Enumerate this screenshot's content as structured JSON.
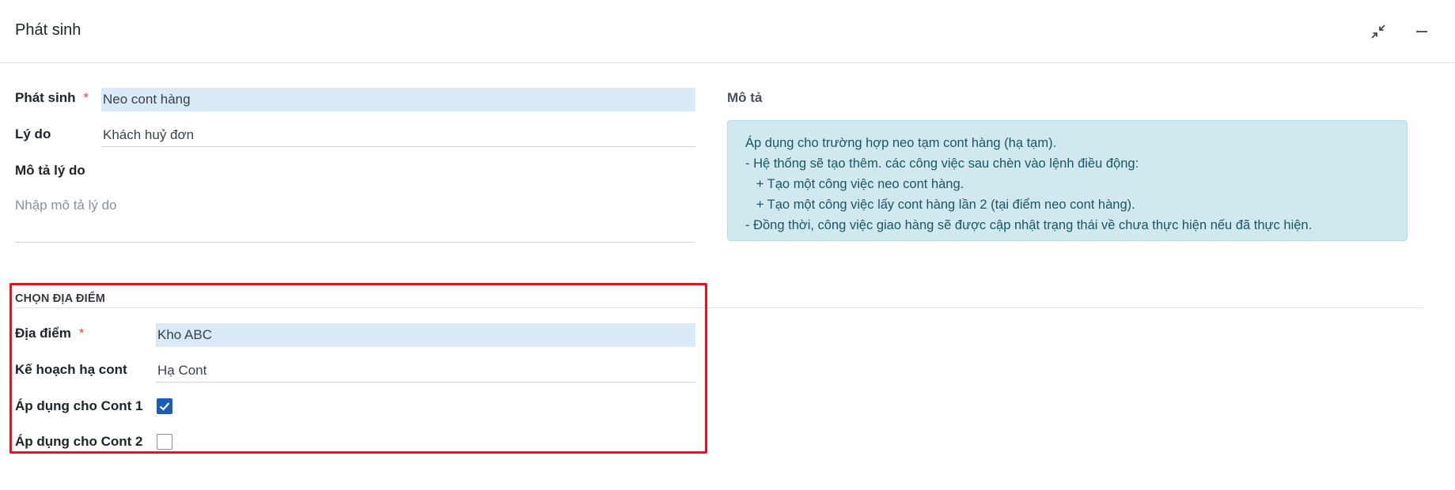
{
  "dialog": {
    "title": "Phát sinh"
  },
  "form": {
    "phat_sinh_label": "Phát sinh",
    "phat_sinh_value": "Neo cont hàng",
    "ly_do_label": "Lý do",
    "ly_do_value": "Khách huỷ đơn",
    "mo_ta_ly_do_label": "Mô tả lý do",
    "mo_ta_ly_do_placeholder": "Nhập mô tả lý do",
    "required_mark": "*"
  },
  "description": {
    "label": "Mô tả",
    "lines": [
      "Áp dụng cho trường hợp neo tạm cont hàng (hạ tạm).",
      "- Hệ thống sẽ tạo thêm. các công việc sau chèn vào lệnh điều động:",
      "   + Tạo một công việc neo cont hàng.",
      "   + Tạo một công việc lấy cont hàng lần 2 (tại điểm neo cont hàng).",
      "- Đồng thời, công việc giao hàng sẽ được cập nhật trạng thái về chưa thực hiện nếu đã thực hiện."
    ]
  },
  "location_section": {
    "title": "CHỌN ĐỊA ĐIỂM",
    "dia_diem_label": "Địa điểm",
    "dia_diem_value": "Kho ABC",
    "ke_hoach_label": "Kế hoạch hạ cont",
    "ke_hoach_value": "Hạ Cont",
    "cont1_label": "Áp dụng cho Cont 1",
    "cont1_checked": true,
    "cont2_label": "Áp dụng cho Cont 2",
    "cont2_checked": false
  },
  "colors": {
    "required_field_bg": "#d9eaf9",
    "description_bg": "#cfe9ee",
    "checkbox_checked": "#1c5db5",
    "highlight_border": "#e8141c"
  }
}
